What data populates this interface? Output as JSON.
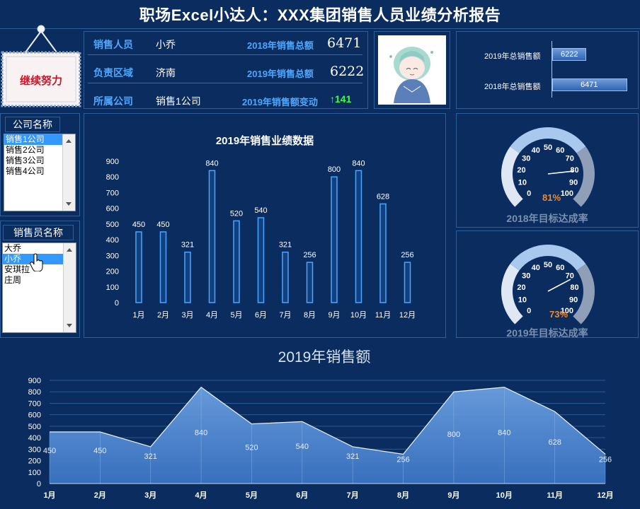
{
  "header": {
    "title": "职场Excel小达人：XXX集团销售人员业绩分析报告"
  },
  "badge": {
    "text": "继续努力"
  },
  "info": {
    "salesperson_label": "销售人员",
    "salesperson_value": "小乔",
    "region_label": "负责区域",
    "region_value": "济南",
    "company_label": "所属公司",
    "company_value": "销售1公司",
    "total_2018_label": "2018年销售总额",
    "total_2018_value": "6471",
    "total_2019_label": "2019年销售总额",
    "total_2019_value": "6222",
    "change_label": "2019年销售额变动",
    "change_arrow": "↑",
    "change_value": "141"
  },
  "company_box": {
    "title": "公司名称",
    "items": [
      "销售1公司",
      "销售2公司",
      "销售3公司",
      "销售4公司"
    ],
    "selected": 0
  },
  "person_box": {
    "title": "销售员名称",
    "items": [
      "大乔",
      "小乔",
      "安琪拉",
      "庄周"
    ],
    "selected": 1
  },
  "totals_chart": {
    "items": [
      {
        "label": "2019年总销售额",
        "value": 6222
      },
      {
        "label": "2018年总销售额",
        "value": 6471
      }
    ]
  },
  "gauges": [
    {
      "caption": "2018年目标达成率",
      "percent_label": "81%",
      "value": 81,
      "ticks": [
        "0",
        "10",
        "20",
        "30",
        "40",
        "50",
        "60",
        "70",
        "80",
        "90",
        "100"
      ]
    },
    {
      "caption": "2019年目标达成率",
      "percent_label": "73%",
      "value": 73,
      "ticks": [
        "0",
        "10",
        "20",
        "30",
        "40",
        "50",
        "60",
        "70",
        "80",
        "90",
        "100"
      ]
    }
  ],
  "colors": {
    "background": "#0b2c5e",
    "accent": "#4ea7ff",
    "up": "#3dff4a",
    "gauge_pct": "#f08a2c"
  },
  "chart_data": [
    {
      "type": "bar",
      "title": "2019年销售业绩数据",
      "categories": [
        "1月",
        "2月",
        "3月",
        "4月",
        "5月",
        "6月",
        "7月",
        "8月",
        "9月",
        "10月",
        "11月",
        "12月"
      ],
      "values": [
        450,
        450,
        321,
        840,
        520,
        540,
        321,
        256,
        800,
        840,
        628,
        256
      ],
      "yticks": [
        "0",
        "100",
        "200",
        "300",
        "400",
        "500",
        "600",
        "700",
        "800",
        "900"
      ],
      "ylim": [
        0,
        900
      ]
    },
    {
      "type": "area",
      "title": "2019年销售额",
      "categories": [
        "1月",
        "2月",
        "3月",
        "4月",
        "5月",
        "6月",
        "7月",
        "8月",
        "9月",
        "10月",
        "11月",
        "12月"
      ],
      "values": [
        450,
        450,
        321,
        840,
        520,
        540,
        321,
        256,
        800,
        840,
        628,
        256
      ],
      "yticks": [
        "0",
        "100",
        "200",
        "300",
        "400",
        "500",
        "600",
        "700",
        "800",
        "900"
      ],
      "ylim": [
        0,
        900
      ]
    }
  ]
}
